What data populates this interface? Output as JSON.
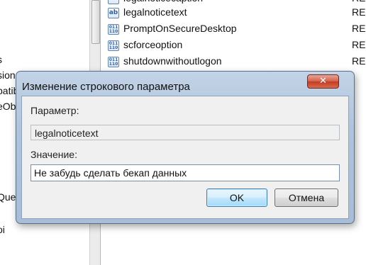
{
  "background": {
    "tree_fragments": [
      "s",
      "sions",
      "patib",
      "eOb",
      "Que",
      "oi"
    ],
    "values": [
      {
        "name": "legalnoticecaption",
        "type": "REG_",
        "icon": "string-value-icon"
      },
      {
        "name": "legalnoticetext",
        "type": "REG_",
        "icon": "string-value-icon"
      },
      {
        "name": "PromptOnSecureDesktop",
        "type": "REG_",
        "icon": "binary-value-icon"
      },
      {
        "name": "scforceoption",
        "type": "REG_",
        "icon": "binary-value-icon"
      },
      {
        "name": "shutdownwithoutlogon",
        "type": "REG_",
        "icon": "binary-value-icon"
      }
    ]
  },
  "dialog": {
    "title": "Изменение строкового параметра",
    "close_glyph": "✕",
    "param_label": "Параметр:",
    "param_value": "legalnoticetext",
    "value_label": "Значение:",
    "value_input": "Не забудь сделать бекап данных",
    "ok_label": "OK",
    "cancel_label": "Отмена"
  },
  "colors": {
    "dialog_frame": "#aec3dc",
    "close_button": "#c23b22",
    "ok_border": "#3c7fb1"
  }
}
